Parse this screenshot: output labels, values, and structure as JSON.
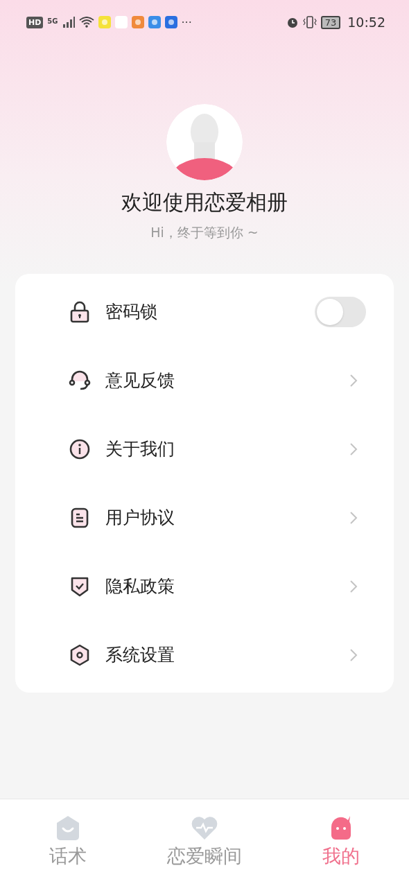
{
  "status_bar": {
    "network_label": "HD",
    "signal_label": "5G",
    "more": "···",
    "battery": "73",
    "time": "10:52"
  },
  "profile": {
    "title": "欢迎使用恋爱相册",
    "subtitle": "Hi，终于等到你 ~"
  },
  "menu": [
    {
      "kind": "toggle",
      "label": "密码锁",
      "on": false
    },
    {
      "kind": "link",
      "label": "意见反馈"
    },
    {
      "kind": "link",
      "label": "关于我们"
    },
    {
      "kind": "link",
      "label": "用户协议"
    },
    {
      "kind": "link",
      "label": "隐私政策"
    },
    {
      "kind": "link",
      "label": "系统设置"
    }
  ],
  "tabs": [
    {
      "label": "话术",
      "selected": false
    },
    {
      "label": "恋爱瞬间",
      "selected": false
    },
    {
      "label": "我的",
      "selected": true
    }
  ]
}
